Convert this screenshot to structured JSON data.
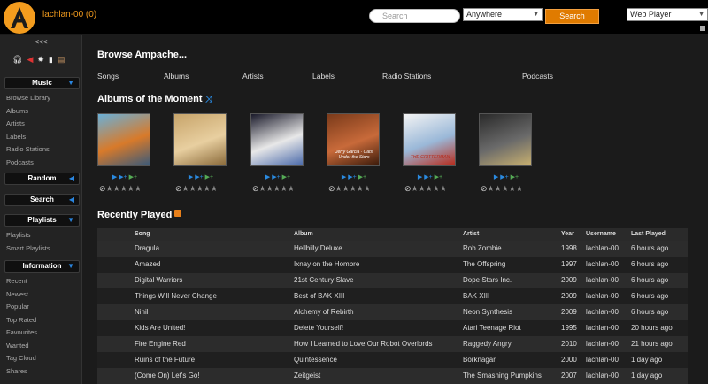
{
  "header": {
    "user": "lachlan-00 (0)",
    "search_placeholder": "Search",
    "search_type": "Anywhere",
    "search_button": "Search",
    "player": "Web Player"
  },
  "sidebar": {
    "collapse": "<<<",
    "sections": {
      "music": {
        "title": "Music",
        "items": [
          "Browse Library",
          "Albums",
          "Artists",
          "Labels",
          "Radio Stations",
          "Podcasts"
        ]
      },
      "random": {
        "title": "Random"
      },
      "search": {
        "title": "Search"
      },
      "playlists": {
        "title": "Playlists",
        "items": [
          "Playlists",
          "Smart Playlists"
        ]
      },
      "information": {
        "title": "Information",
        "items": [
          "Recent",
          "Newest",
          "Popular",
          "Top Rated",
          "Favourites",
          "Wanted",
          "Tag Cloud",
          "Shares"
        ]
      }
    }
  },
  "browse": {
    "title": "Browse Ampache...",
    "links": [
      "Songs",
      "Albums",
      "Artists",
      "Labels",
      "Radio Stations",
      "Podcasts"
    ]
  },
  "albums_moment": {
    "title": "Albums of the Moment",
    "albums": [
      {
        "cover_text": "",
        "colors": [
          "#6ab0d8",
          "#d87a2a",
          "#3a5a7a"
        ]
      },
      {
        "cover_text": "",
        "colors": [
          "#c7a46a",
          "#e8cfa0",
          "#8a6a3a"
        ]
      },
      {
        "cover_text": "",
        "colors": [
          "#1a1a2a",
          "#e8e8e8",
          "#4a6aaa"
        ]
      },
      {
        "cover_text": "Jerry Garcia · Cats Under the Stars",
        "colors": [
          "#7a3a1a",
          "#c86a3a",
          "#3a1a0a"
        ]
      },
      {
        "cover_text": "THE GRITTERMAN",
        "colors": [
          "#f4f4f4",
          "#9ab8d8",
          "#b82a1a"
        ]
      },
      {
        "cover_text": "",
        "colors": [
          "#2a2a2a",
          "#6a6a6a",
          "#c8b070"
        ]
      }
    ]
  },
  "recent": {
    "title": "Recently Played",
    "columns": [
      "Song",
      "Album",
      "Artist",
      "Year",
      "Username",
      "Last Played"
    ],
    "rows": [
      {
        "song": "Dragula",
        "album": "Hellbilly Deluxe",
        "artist": "Rob Zombie",
        "year": "1998",
        "user": "lachlan-00",
        "played": "6 hours ago"
      },
      {
        "song": "Amazed",
        "album": "Ixnay on the Hombre",
        "artist": "The Offspring",
        "year": "1997",
        "user": "lachlan-00",
        "played": "6 hours ago"
      },
      {
        "song": "Digital Warriors",
        "album": "21st Century Slave",
        "artist": "Dope Stars Inc.",
        "year": "2009",
        "user": "lachlan-00",
        "played": "6 hours ago"
      },
      {
        "song": "Things Will Never Change",
        "album": "Best of BAK XIII",
        "artist": "BAK XIII",
        "year": "2009",
        "user": "lachlan-00",
        "played": "6 hours ago"
      },
      {
        "song": "Nihil",
        "album": "Alchemy of Rebirth",
        "artist": "Neon Synthesis",
        "year": "2009",
        "user": "lachlan-00",
        "played": "6 hours ago"
      },
      {
        "song": "Kids Are United!",
        "album": "Delete Yourself!",
        "artist": "Atari Teenage Riot",
        "year": "1995",
        "user": "lachlan-00",
        "played": "20 hours ago"
      },
      {
        "song": "Fire Engine Red",
        "album": "How I Learned to Love Our Robot Overlords",
        "artist": "Raggedy Angry",
        "year": "2010",
        "user": "lachlan-00",
        "played": "21 hours ago"
      },
      {
        "song": "Ruins of the Future",
        "album": "Quintessence",
        "artist": "Borknagar",
        "year": "2000",
        "user": "lachlan-00",
        "played": "1 day ago"
      },
      {
        "song": "(Come On) Let's Go!",
        "album": "Zeitgeist",
        "artist": "The Smashing Pumpkins",
        "year": "2007",
        "user": "lachlan-00",
        "played": "1 day ago"
      }
    ]
  }
}
